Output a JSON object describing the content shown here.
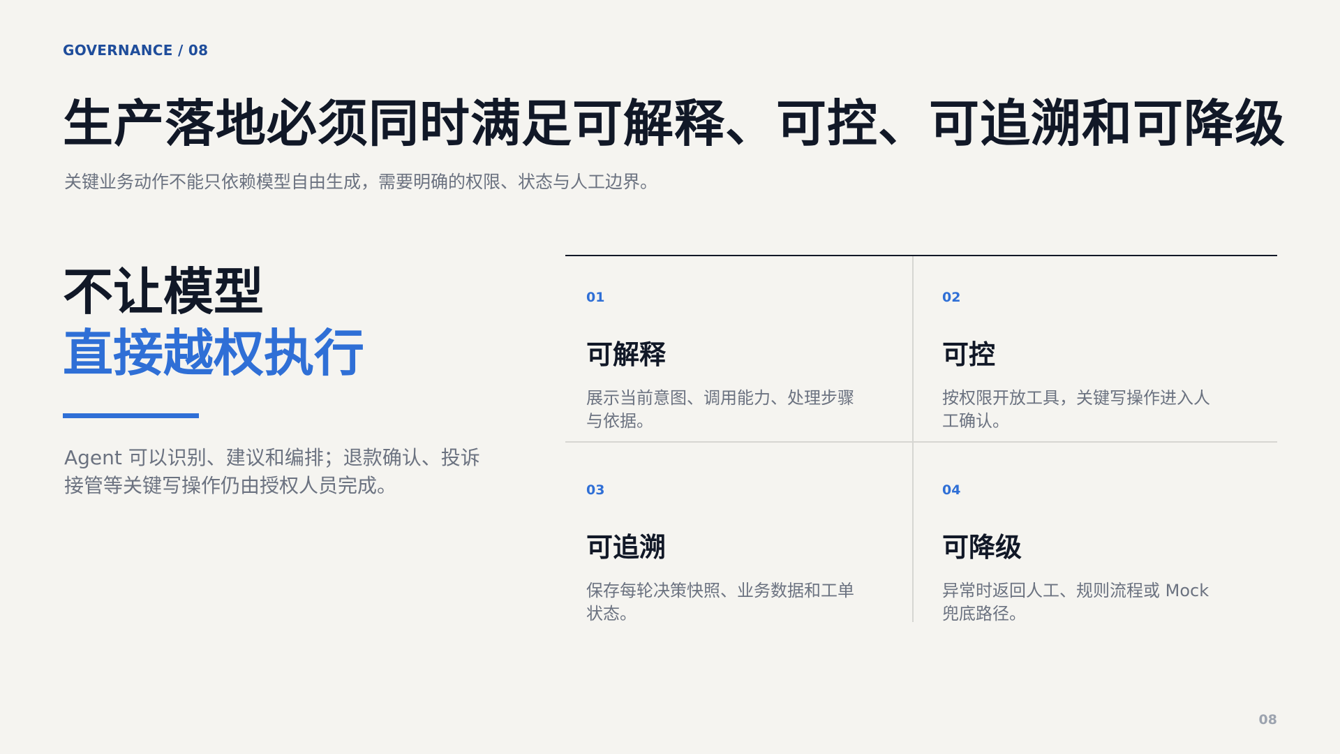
{
  "eyebrow": "GOVERNANCE / 08",
  "title": "生产落地必须同时满足可解释、可控、可追溯和可降级",
  "subtitle": "关键业务动作不能只依赖模型自由生成，需要明确的权限、状态与人工边界。",
  "left": {
    "headline_line1": "不让模型",
    "headline_line2": "直接越权执行",
    "body": "Agent 可以识别、建议和编排；退款确认、投诉接管等关键写操作仍由授权人员完成。"
  },
  "cards": [
    {
      "num": "01",
      "title": "可解释",
      "desc": "展示当前意图、调用能力、处理步骤与依据。"
    },
    {
      "num": "02",
      "title": "可控",
      "desc": "按权限开放工具，关键写操作进入人工确认。"
    },
    {
      "num": "03",
      "title": "可追溯",
      "desc": "保存每轮决策快照、业务数据和工单状态。"
    },
    {
      "num": "04",
      "title": "可降级",
      "desc": "异常时返回人工、规则流程或 Mock 兜底路径。"
    }
  ],
  "page_number": "08",
  "colors": {
    "accent": "#2f6fd6",
    "eyebrow": "#1f4d9b",
    "text_dark": "#111827",
    "text_muted": "#6b7280",
    "background": "#f5f4f0"
  }
}
